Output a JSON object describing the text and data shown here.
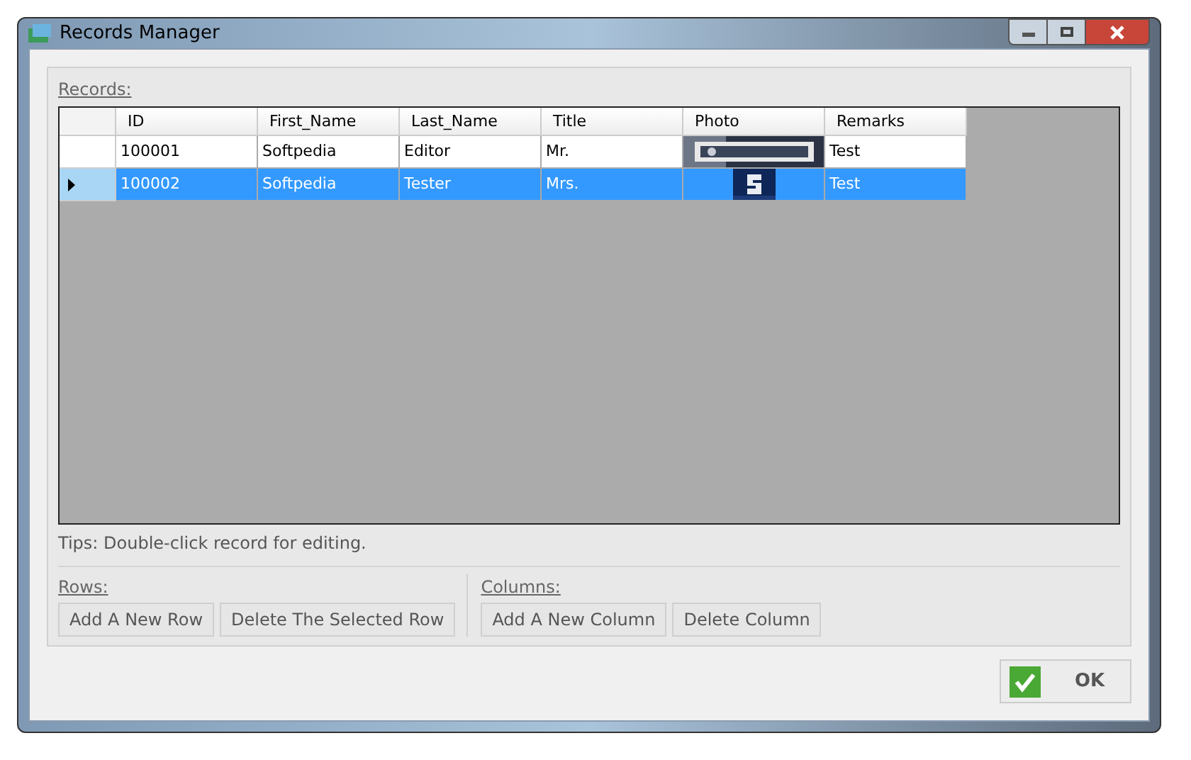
{
  "window": {
    "title": "Records Manager"
  },
  "records": {
    "label": "Records:",
    "columns": [
      "ID",
      "First_Name",
      "Last_Name",
      "Title",
      "Photo",
      "Remarks"
    ],
    "rows": [
      {
        "id": "100001",
        "first_name": "Softpedia",
        "last_name": "Editor",
        "title": "Mr.",
        "remarks": "Test",
        "selected": false
      },
      {
        "id": "100002",
        "first_name": "Softpedia",
        "last_name": "Tester",
        "title": "Mrs.",
        "remarks": "Test",
        "selected": true
      }
    ]
  },
  "tips": "Tips: Double-click record for editing.",
  "rows_group": {
    "label": "Rows:",
    "buttons": [
      "Add A New Row",
      "Delete The Selected Row"
    ]
  },
  "columns_group": {
    "label": "Columns:",
    "buttons": [
      "Add A New Column",
      "Delete Column"
    ]
  },
  "ok_button": "OK"
}
